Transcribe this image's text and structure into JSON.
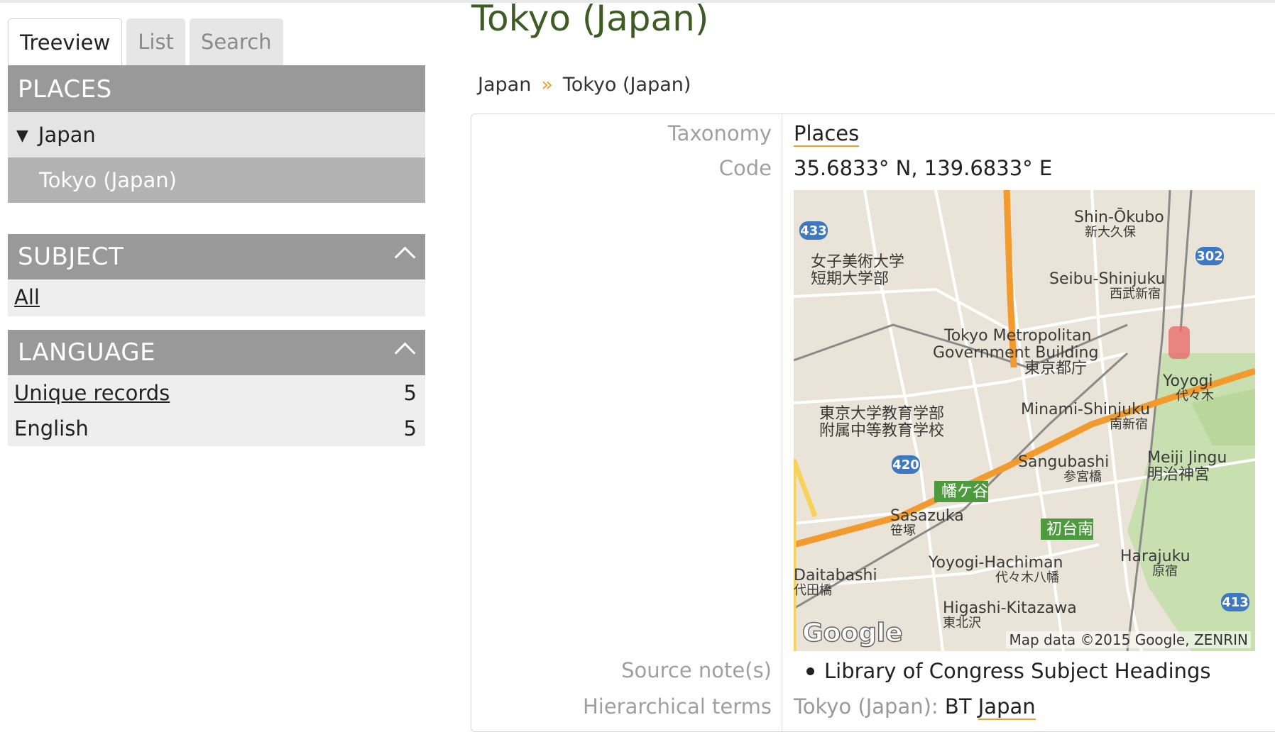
{
  "tabs": [
    {
      "label": "Treeview",
      "active": true
    },
    {
      "label": "List",
      "active": false
    },
    {
      "label": "Search",
      "active": false
    }
  ],
  "places": {
    "heading": "PLACES",
    "items": [
      {
        "label": "Japan",
        "expanded": true
      },
      {
        "label": "Tokyo (Japan)",
        "selected": true
      }
    ]
  },
  "subject": {
    "heading": "SUBJECT",
    "items": [
      {
        "label": "All"
      }
    ]
  },
  "language": {
    "heading": "LANGUAGE",
    "items": [
      {
        "label": "Unique records",
        "count": "5"
      },
      {
        "label": "English",
        "count": "5"
      }
    ]
  },
  "page": {
    "title": "Tokyo (Japan)",
    "breadcrumb": [
      "Japan",
      "Tokyo (Japan)"
    ],
    "breadcrumb_sep": "»"
  },
  "record": {
    "taxonomy_label": "Taxonomy",
    "taxonomy_value": "Places",
    "code_label": "Code",
    "code_value": "35.6833° N, 139.6833° E",
    "source_label": "Source note(s)",
    "source_items": [
      "Library of Congress Subject Headings"
    ],
    "hier_label": "Hierarchical terms",
    "hier_prefix": "Tokyo (Japan):",
    "hier_rel": "BT",
    "hier_term": "Japan"
  },
  "map": {
    "labels": {
      "shin_okubo": "Shin-Ōkubo",
      "shin_okubo_jp": "新大久保",
      "seibu": "Seibu-Shinjuku",
      "seibu_jp": "西武新宿",
      "joshi1": "女子美術大学",
      "joshi2": "短期大学部",
      "tmg1": "Tokyo Metropolitan",
      "tmg2": "Government Building",
      "tmg_jp": "東京都庁",
      "yoyogi": "Yoyogi",
      "yoyogi_jp": "代々木",
      "todai1": "東京大学教育学部",
      "todai2": "附属中等教育学校",
      "minami": "Minami-Shinjuku",
      "minami_jp": "南新宿",
      "meiji": "Meiji Jingu",
      "meiji_jp": "明治神宮",
      "sangubashi": "Sangubashi",
      "sangubashi_jp": "参宮橋",
      "hatagaya": "幡ケ谷",
      "sasazuka": "Sasazuka",
      "sasazuka_jp": "笹塚",
      "hatsudai": "初台南",
      "harajuku": "Harajuku",
      "harajuku_jp": "原宿",
      "yoyogihachiman": "Yoyogi-Hachiman",
      "yoyogihachiman_jp": "代々木八幡",
      "daitabashi": "Daitabashi",
      "daitabashi_jp": "代田橋",
      "higashi": "Higashi-Kitazawa",
      "higashi_jp": "東北沢"
    },
    "routes": [
      "433",
      "302",
      "420",
      "413"
    ],
    "logo": "Google",
    "copyright": "Map data ©2015 Google, ZENRIN",
    "colors": {
      "land": "#e9e4d7",
      "park": "#c8dfb0",
      "highway": "#f29a2e",
      "road": "#ffffff",
      "rail": "#8a8a8a",
      "route_shield": "#3d78c2"
    }
  }
}
